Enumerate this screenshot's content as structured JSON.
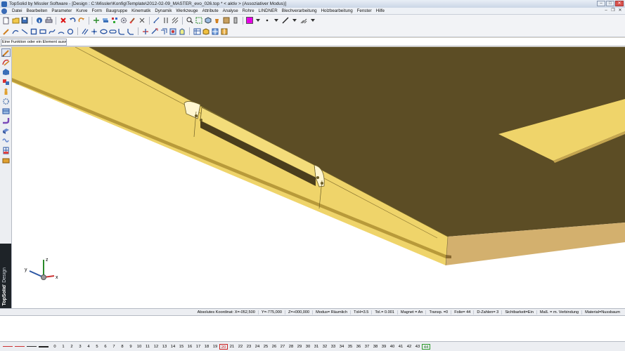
{
  "window": {
    "title": "TopSolid by Missler Software - [Design : C:\\Missler\\Konfig\\Template\\2012-02-09_MASTER_evo_026.top * < aktiv > (Assoziativer Modus)]",
    "minimize": "–",
    "maximize": "□",
    "close": "✕"
  },
  "menu": {
    "items": [
      "Datei",
      "Bearbeiten",
      "Parameter",
      "Kurve",
      "Form",
      "Baugruppe",
      "Kinematik",
      "Dynamik",
      "Werkzeuge",
      "Attribute",
      "Analyse",
      "Rohre",
      "LINDNER",
      "Blechverarbeitung",
      "Holzbearbeitung",
      "Fenster",
      "Hilfe"
    ],
    "mdi_minimize": "–",
    "mdi_restore": "❐",
    "mdi_close": "✕"
  },
  "toolbar_top": {
    "icons": [
      "new-file-icon",
      "open-file-icon",
      "save-icon",
      "info-icon",
      "print-icon",
      "delete-icon",
      "undo-icon",
      "redo-icon",
      "move-icon",
      "layers-icon",
      "explode-icon",
      "gear-icon",
      "brush-icon",
      "cut-icon",
      "measure-icon",
      "clip-icon",
      "hatch-icon",
      "zoom-icon",
      "fit-icon",
      "view-icon",
      "paint-icon",
      "material-icon",
      "light-icon"
    ],
    "color_swatch": "#e600e6"
  },
  "toolbar_draw": {
    "icons": [
      "edit-icon",
      "curve-icon",
      "line-icon",
      "square-icon",
      "rectangle-icon",
      "spline-icon",
      "arc-icon",
      "circle-icon",
      "parallel-icon",
      "point-icon",
      "ellipse-icon",
      "slot-icon",
      "fillet-icon",
      "chamfer-icon",
      "trim-icon",
      "extend-icon",
      "offset-icon",
      "hole-icon",
      "extrude-icon",
      "table-icon",
      "cube-icon",
      "grid-icon",
      "mirror-icon"
    ]
  },
  "prompt": {
    "text": "Eine Funktion oder ein Element auswählen"
  },
  "left_toolbar": {
    "icons": [
      "pencil-icon",
      "curve-tool-icon",
      "shape-icon",
      "assembly-icon",
      "person-icon",
      "gear-tool-icon",
      "sheet-icon",
      "pipe-icon",
      "wood-icon",
      "spring-icon",
      "window-icon",
      "block-icon"
    ],
    "brand": "TopSolid",
    "brand_sub": "' Design"
  },
  "axes": {
    "x": "x",
    "y": "y",
    "z": "z"
  },
  "status": {
    "fields": [
      "Absolutes Koordinat: X=-052,500",
      "Y=-775,000",
      "Z=+000,000",
      "Modus= Räumlich",
      "TxH=3.5",
      "Tol.= 0.001",
      "Magnet = An",
      "Transp. =0",
      "Folie= 44",
      "D-Zahlen= 3",
      "Sichtbarkeit=Ein",
      "Maß. = m. Verbindung",
      "Material=Nussbaum"
    ]
  },
  "layers": {
    "line_colors": [
      "#cc3333",
      "#cc3333",
      "#333333",
      "#333333"
    ],
    "values": [
      "0",
      "1",
      "2",
      "3",
      "4",
      "5",
      "6",
      "7",
      "8",
      "9",
      "10",
      "11",
      "12",
      "13",
      "14",
      "15",
      "16",
      "17",
      "18",
      "19",
      "20",
      "21",
      "22",
      "23",
      "24",
      "25",
      "26",
      "27",
      "28",
      "29",
      "30",
      "31",
      "32",
      "33",
      "34",
      "35",
      "36",
      "37",
      "38",
      "39",
      "40",
      "41",
      "42",
      "43",
      "44"
    ],
    "current": "20",
    "highlighted": "44"
  }
}
